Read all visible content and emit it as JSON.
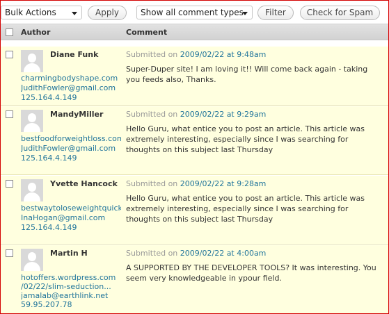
{
  "toolbar": {
    "bulk_actions": "Bulk Actions",
    "apply": "Apply",
    "comment_type": "Show all comment types",
    "filter": "Filter",
    "check_spam": "Check for Spam"
  },
  "table": {
    "col_author": "Author",
    "col_comment": "Comment"
  },
  "comments": [
    {
      "name": "Diane Funk",
      "url": "charmingbodyshape.com",
      "email": "JudithFowler@gmail.com",
      "ip": "125.164.4.149",
      "submitted_prefix": "Submitted on",
      "date": "2009/02/22 at 9:48am",
      "text": "Super-Duper site! I am loving it!! Will come back again - taking you feeds also, Thanks."
    },
    {
      "name": "MandyMiller",
      "url": "bestfoodforweightloss.com",
      "email": "JudithFowler@gmail.com",
      "ip": "125.164.4.149",
      "submitted_prefix": "Submitted on",
      "date": "2009/02/22 at 9:29am",
      "text": "Hello Guru, what entice you to post an article. This article was extremely interesting, especially since I was searching for thoughts on this subject last Thursday"
    },
    {
      "name": "Yvette Hancock",
      "url": "bestwaytoloseweightquickly",
      "email": "InaHogan@gmail.com",
      "ip": "125.164.4.149",
      "submitted_prefix": "Submitted on",
      "date": "2009/02/22 at 9:28am",
      "text": "Hello Guru, what entice you to post an article. This article was extremely interesting, especially since I was searching for thoughts on this subject last Thursday"
    },
    {
      "name": "Martin H",
      "url": "hotoffers.wordpress.com",
      "url2": "/02/22/slim-seduction...",
      "email": "jamalab@earthlink.net",
      "ip": "59.95.207.78",
      "submitted_prefix": "Submitted on",
      "date": "2009/02/22 at 4:00am",
      "text": "A SUPPORTED BY THE DEVELOPER TOOLS? It was interesting. You seem very knowledgeable in ypour field."
    }
  ]
}
